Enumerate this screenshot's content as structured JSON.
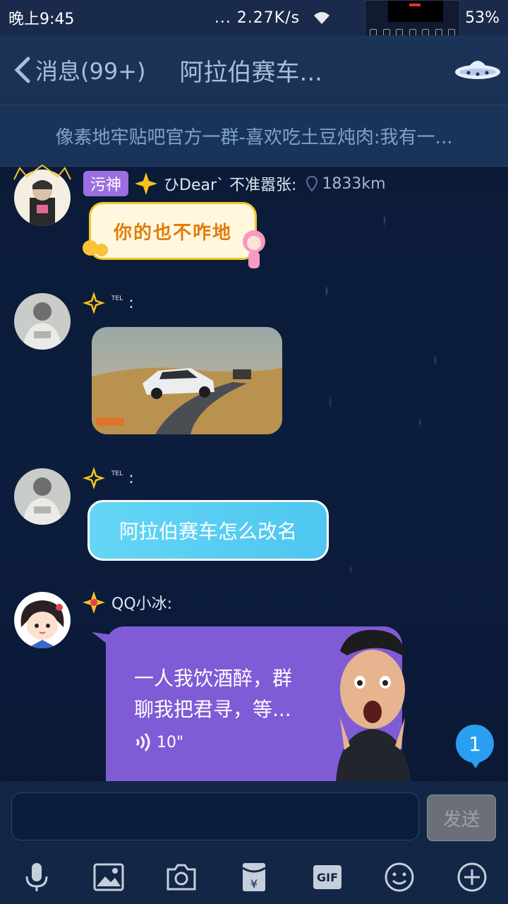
{
  "status_bar": {
    "time": "晚上9:45",
    "network_speed": "... 2.27K/s",
    "battery": "53%"
  },
  "nav": {
    "back_label": "消息(99+)",
    "title": "阿拉伯赛车..."
  },
  "notice": {
    "text": "像素地牢贴吧官方一群-喜欢吃土豆炖肉:我有一..."
  },
  "messages": [
    {
      "badge": "污神",
      "sender": "ひDear` 不准嚣张:",
      "distance": "1833km",
      "sticker_text": "你的也不咋地"
    },
    {
      "sender_tag": "TEL",
      "colon": ":",
      "type": "image"
    },
    {
      "sender_tag": "TEL",
      "colon": ":",
      "text": "阿拉伯赛车怎么改名"
    },
    {
      "sender": "QQ小冰:",
      "voice_text_line1": "一人我饮酒醉，群",
      "voice_text_line2": "聊我把君寻，等...",
      "voice_duration": "10\""
    }
  ],
  "unread_count": "1",
  "input": {
    "value": "",
    "send_label": "发送"
  },
  "toolbar": {
    "gif_label": "GIF"
  }
}
